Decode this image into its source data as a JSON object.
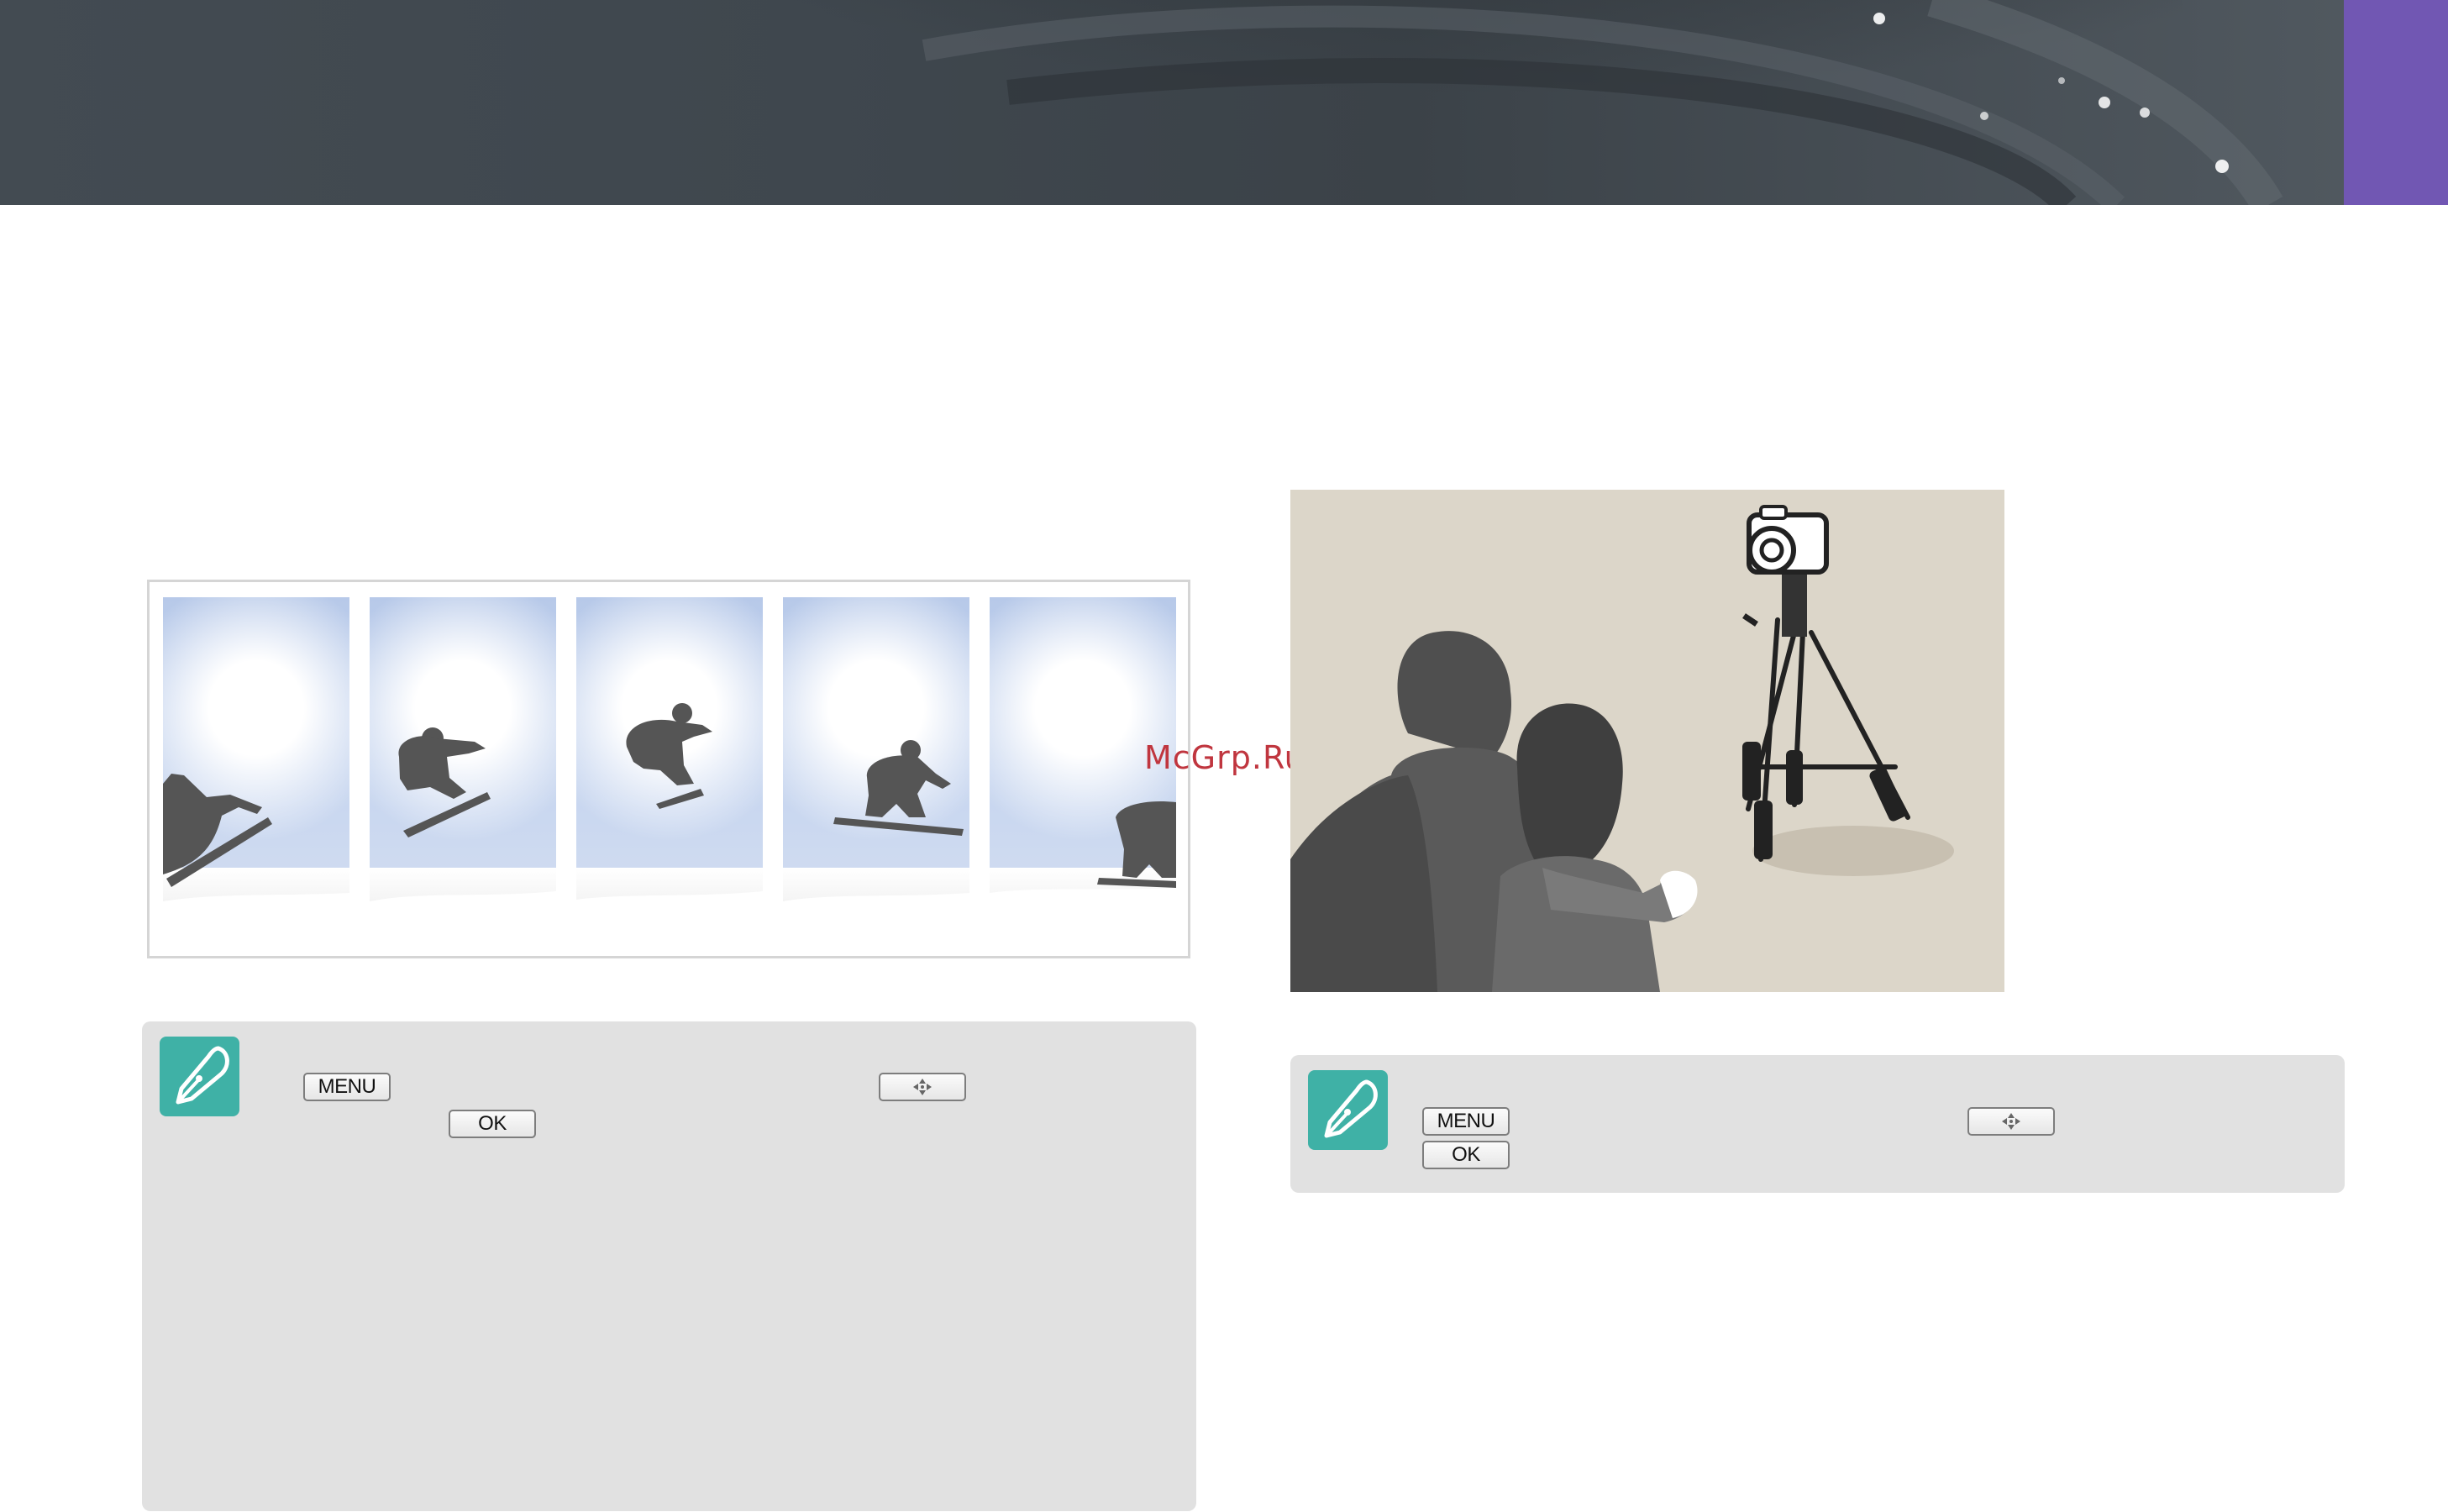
{
  "header": {
    "accent_color": "#7157b3"
  },
  "watermark": {
    "text": "McGrp.Ru"
  },
  "left_column": {
    "illustration": {
      "description_icon_names": [
        "snowboarder-silhouette"
      ],
      "panel_count": 5
    },
    "note": {
      "icon_name": "note-pen-icon",
      "keys": {
        "menu": "MENU",
        "ok": "OK",
        "navigation_icon": "navigation-pad-icon"
      }
    }
  },
  "right_column": {
    "illustration": {
      "description_icon_names": [
        "couple-silhouette",
        "camera-on-tripod"
      ]
    },
    "note": {
      "icon_name": "note-pen-icon",
      "keys": {
        "menu": "MENU",
        "ok": "OK",
        "navigation_icon": "navigation-pad-icon"
      }
    }
  }
}
